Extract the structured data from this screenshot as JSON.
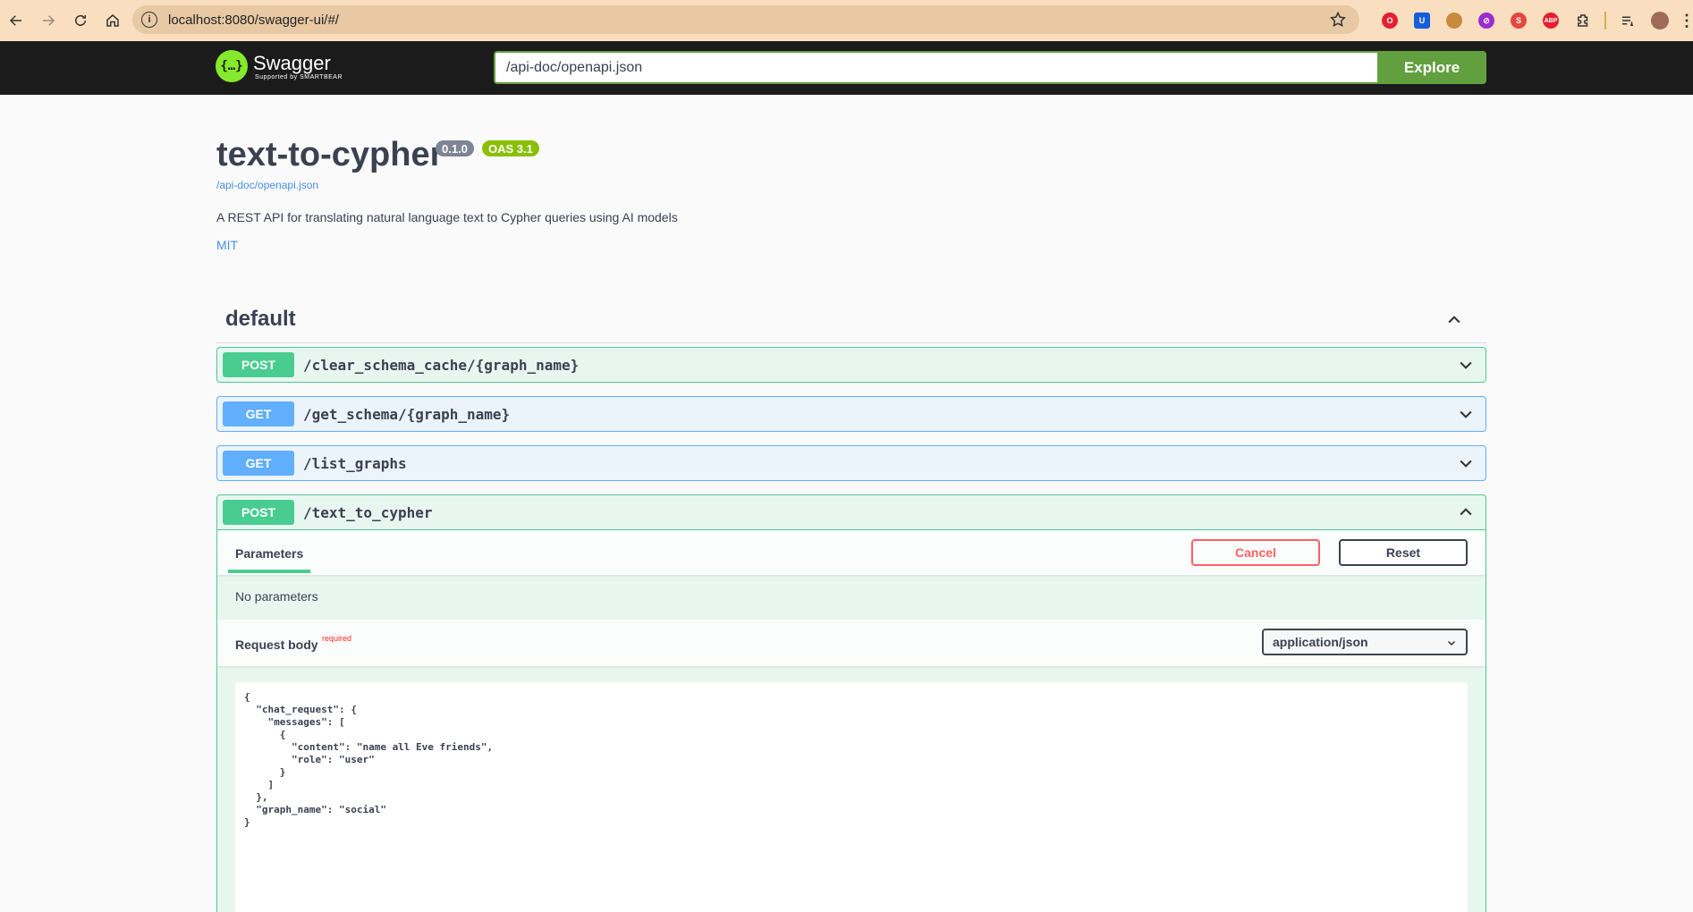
{
  "browser": {
    "url": "localhost:8080/swagger-ui/#/",
    "extensions": [
      "opera-icon",
      "bitwarden-icon",
      "cookie-icon",
      "block-icon",
      "shield-icon",
      "adblock-icon",
      "puzzle-icon",
      "media-icon",
      "profile-avatar"
    ]
  },
  "topbar": {
    "logo_name": "Swagger",
    "logo_sub": "Supported by SMARTBEAR",
    "spec_url": "/api-doc/openapi.json",
    "explore_label": "Explore"
  },
  "info": {
    "title": "text-to-cypher",
    "version": "0.1.0",
    "oas": "OAS 3.1",
    "spec_link": "/api-doc/openapi.json",
    "description": "A REST API for translating natural language text to Cypher queries using AI models",
    "license": "MIT"
  },
  "tag": {
    "name": "default"
  },
  "operations": [
    {
      "method": "POST",
      "path": "/clear_schema_cache/{graph_name}"
    },
    {
      "method": "GET",
      "path": "/get_schema/{graph_name}"
    },
    {
      "method": "GET",
      "path": "/list_graphs"
    },
    {
      "method": "POST",
      "path": "/text_to_cypher"
    }
  ],
  "expanded": {
    "params_tab": "Parameters",
    "cancel_label": "Cancel",
    "reset_label": "Reset",
    "no_params": "No parameters",
    "request_body_label": "Request body",
    "required_label": "required",
    "content_type": "application/json",
    "body": "{\n  \"chat_request\": {\n    \"messages\": [\n      {\n        \"content\": \"name all Eve friends\",\n        \"role\": \"user\"\n      }\n    ]\n  },\n  \"graph_name\": \"social\"\n}"
  },
  "colors": {
    "post": "#49cc90",
    "get": "#61affe",
    "topbar": "#1b1b1b",
    "accent_green": "#62a03f"
  }
}
